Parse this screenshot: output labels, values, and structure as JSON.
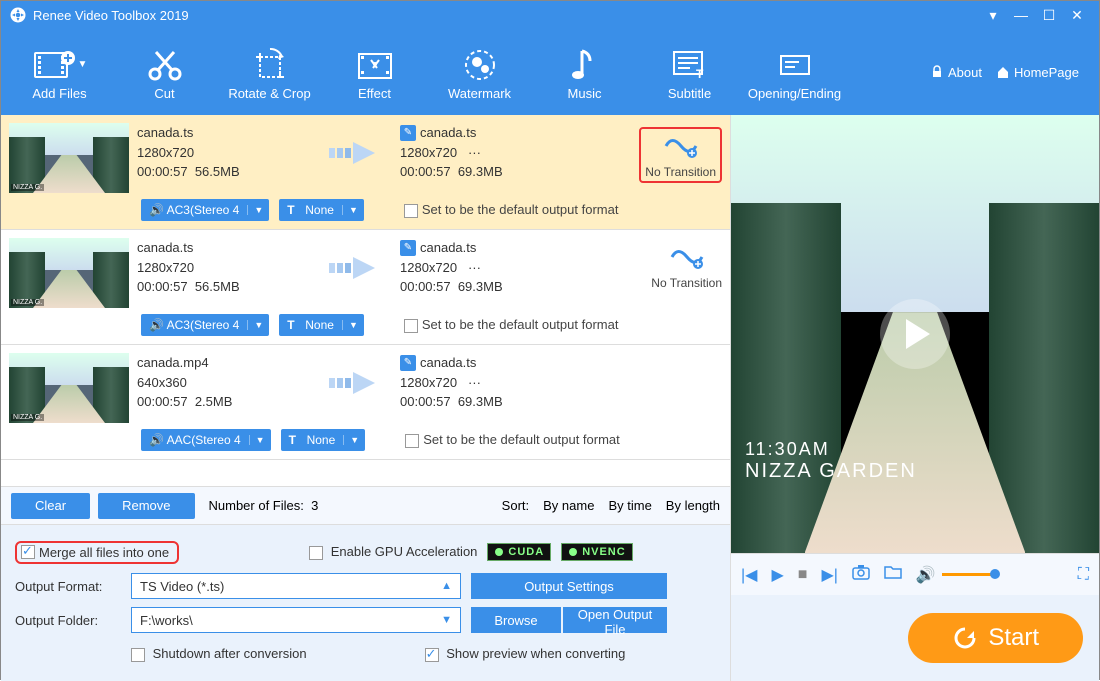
{
  "app": {
    "title": "Renee Video Toolbox 2019"
  },
  "toolbar": {
    "items": [
      "Add Files",
      "Cut",
      "Rotate & Crop",
      "Effect",
      "Watermark",
      "Music",
      "Subtitle",
      "Opening/Ending"
    ],
    "about": "About",
    "homepage": "HomePage"
  },
  "files": [
    {
      "name": "canada.ts",
      "res": "1280x720",
      "dur": "00:00:57",
      "size": "56.5MB",
      "outname": "canada.ts",
      "outres": "1280x720",
      "outdur": "00:00:57",
      "outsize": "69.3MB",
      "audio": "AC3(Stereo 4",
      "fx": "None",
      "trans": "No Transition",
      "selected": true,
      "redbox": true
    },
    {
      "name": "canada.ts",
      "res": "1280x720",
      "dur": "00:00:57",
      "size": "56.5MB",
      "outname": "canada.ts",
      "outres": "1280x720",
      "outdur": "00:00:57",
      "outsize": "69.3MB",
      "audio": "AC3(Stereo 4",
      "fx": "None",
      "trans": "No Transition",
      "selected": false,
      "redbox": false
    },
    {
      "name": "canada.mp4",
      "res": "640x360",
      "dur": "00:00:57",
      "size": "2.5MB",
      "outname": "canada.ts",
      "outres": "1280x720",
      "outdur": "00:00:57",
      "outsize": "69.3MB",
      "audio": "AAC(Stereo 4",
      "fx": "None",
      "trans": "",
      "selected": false,
      "redbox": false
    }
  ],
  "row_labels": {
    "default_out": "Set to be the default output format",
    "ellipsis": "···"
  },
  "listfoot": {
    "clear": "Clear",
    "remove": "Remove",
    "nfiles_label": "Number of Files:",
    "nfiles": "3",
    "sort_label": "Sort:",
    "s1": "By name",
    "s2": "By time",
    "s3": "By length"
  },
  "settings": {
    "merge": "Merge all files into one",
    "gpu": "Enable GPU Acceleration",
    "cuda": "CUDA",
    "nvenc": "NVENC",
    "format_label": "Output Format:",
    "format_value": "TS Video (*.ts)",
    "output_settings": "Output Settings",
    "folder_label": "Output Folder:",
    "folder_value": "F:\\works\\",
    "browse": "Browse",
    "open_out": "Open Output File",
    "shutdown": "Shutdown after conversion",
    "show_preview": "Show preview when converting"
  },
  "preview": {
    "time": "11:30AM",
    "place": "NIZZA GARDEN"
  },
  "buttons": {
    "start": "Start"
  }
}
